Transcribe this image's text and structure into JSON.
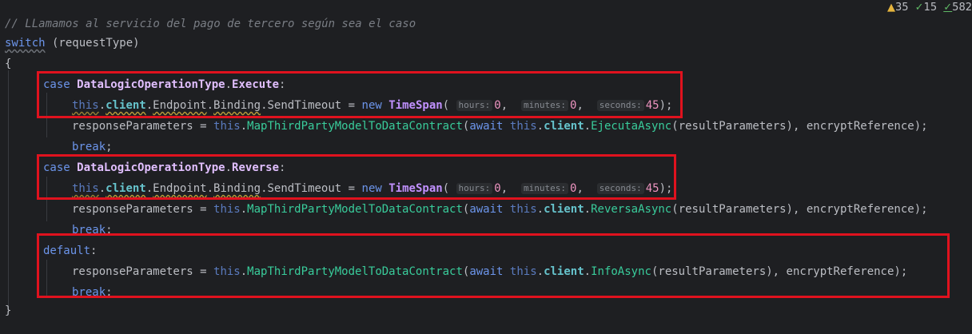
{
  "inspections": {
    "warnings": "35",
    "weak_warnings": "15",
    "typos": "582"
  },
  "code": {
    "comment": "// LLamamos al servicio del pago de tercero según sea el caso",
    "switch_kw": "switch",
    "switch_expr": " (requestType)",
    "open_brace": "{",
    "close_brace": "}",
    "case_kw": "case",
    "enum_type": "DataLogicOperationType",
    "execute_member": "Execute",
    "reverse_member": "Reverse",
    "colon": ":",
    "this_kw": "this",
    "client": "client",
    "endpoint": "Endpoint",
    "binding": "Binding",
    "send_timeout": "SendTimeout",
    "eq_new": " = ",
    "new_kw": "new",
    "timespan": "TimeSpan",
    "hint_hours": "hours:",
    "hint_minutes": "minutes:",
    "hint_seconds": "seconds:",
    "val_hours": "0",
    "val_minutes": "0",
    "val_seconds": "45",
    "response_params": "responseParameters",
    "map_method": "MapThirdPartyModelToDataContract",
    "await_kw": "await",
    "ejecuta_async": "EjecutaAsync",
    "reversa_async": "ReversaAsync",
    "info_async": "InfoAsync",
    "result_params": "resultParameters",
    "encrypt_ref": "encryptReference",
    "break_kw": "break",
    "default_kw": "default"
  }
}
